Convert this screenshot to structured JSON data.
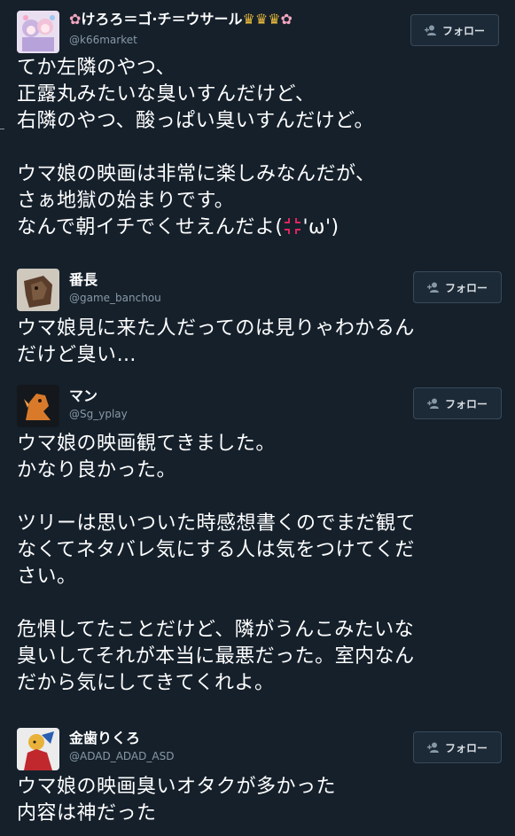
{
  "tweets": [
    {
      "name": "けろろ＝ゴ·チ＝ウサール",
      "name_decor": [
        "✿",
        "♛",
        "♛",
        "♛",
        "✿"
      ],
      "handle": "@k66market",
      "follow_label": "フォロー",
      "text": "てか左隣のやつ、\n正露丸みたいな臭いすんだけど、\n右隣のやつ、酸っぱい臭いすんだけど。\n\nウマ娘の映画は非常に楽しみなんだが、\nさぁ地獄の始まりです。\nなんで朝イチでくせえんだよ(",
      "text_tail": "'ω')",
      "emoji": "anger-symbol"
    },
    {
      "name": "番長",
      "handle": "@game_banchou",
      "follow_label": "フォロー",
      "text": "ウマ娘見に来た人だってのは見りゃわかるん\nだけど臭い…"
    },
    {
      "name": "マン",
      "handle": "@Sg_yplay",
      "follow_label": "フォロー",
      "text": "ウマ娘の映画観てきました。\nかなり良かった。\n\nツリーは思いついた時感想書くのでまだ観て\nなくてネタバレ気にする人は気をつけてくだ\nさい。\n\n危惧してたことだけど、隣がうんこみたいな\n臭いしてそれが本当に最悪だった。室内なん\nだから気にしてきてくれよ。"
    },
    {
      "name": "金歯りくろ",
      "handle": "@ADAD_ADAD_ASD",
      "follow_label": "フォロー",
      "text": "ウマ娘の映画臭いオタクが多かった\n内容は神だった"
    }
  ],
  "colors": {
    "background": "#15202b",
    "text": "#ffffff",
    "handle": "#8899a6",
    "button_border": "#3a4a5a",
    "crown": "#e8b93a",
    "flower": "#f4a6c0",
    "anger": "#e0245e"
  },
  "icons": {
    "follow": "person-add-icon",
    "decor_flower": "flower-icon",
    "decor_crown": "crown-icon"
  }
}
